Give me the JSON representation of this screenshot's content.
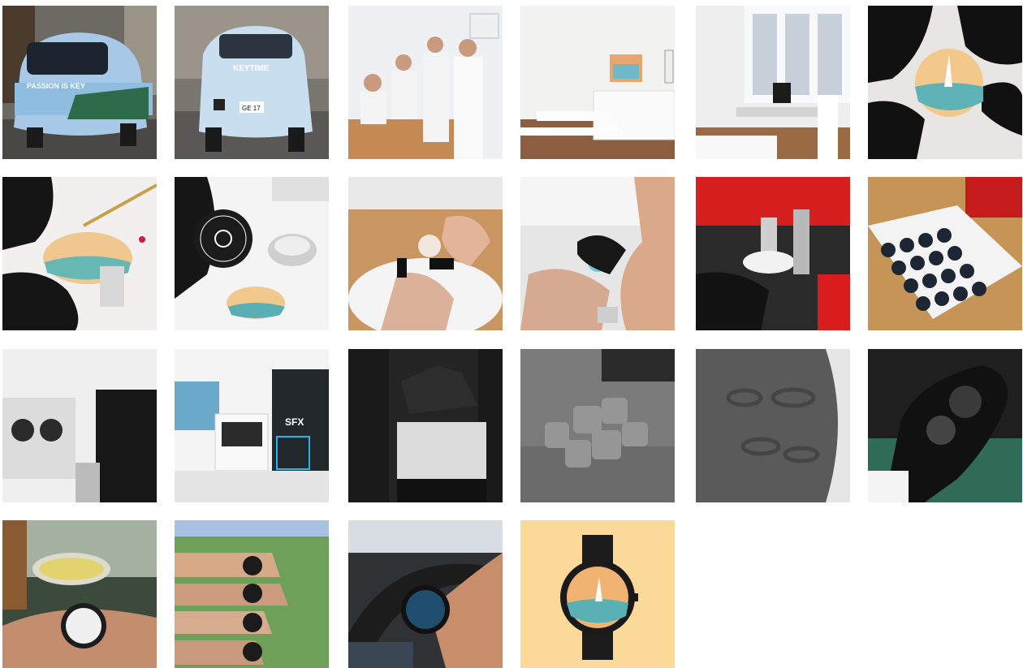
{
  "gallery": {
    "tiles": [
      {
        "id": "microlino-front",
        "texts": [
          "PASSION IS KEY"
        ]
      },
      {
        "id": "microlino-rear",
        "texts": [
          "KEYTIME",
          "GE 17"
        ]
      },
      {
        "id": "team-photo",
        "texts": []
      },
      {
        "id": "office-room",
        "texts": []
      },
      {
        "id": "workshop-room",
        "texts": []
      },
      {
        "id": "gloved-dial",
        "texts": []
      },
      {
        "id": "tweezers-dial",
        "texts": []
      },
      {
        "id": "caseback",
        "texts": []
      },
      {
        "id": "hand-setting-1",
        "texts": []
      },
      {
        "id": "hand-setting-2",
        "texts": []
      },
      {
        "id": "press-machine",
        "texts": []
      },
      {
        "id": "dial-tray",
        "texts": []
      },
      {
        "id": "printer-station",
        "texts": []
      },
      {
        "id": "printer-sfx",
        "texts": [
          "SFX"
        ]
      },
      {
        "id": "printer-closeup",
        "texts": []
      },
      {
        "id": "powder-chunks",
        "texts": []
      },
      {
        "id": "powder-parts",
        "texts": []
      },
      {
        "id": "black-parts-hand",
        "texts": []
      },
      {
        "id": "wrist-fondue",
        "texts": []
      },
      {
        "id": "wrists-meadow",
        "texts": []
      },
      {
        "id": "wrist-driving",
        "texts": []
      },
      {
        "id": "product-watch",
        "texts": []
      }
    ]
  }
}
